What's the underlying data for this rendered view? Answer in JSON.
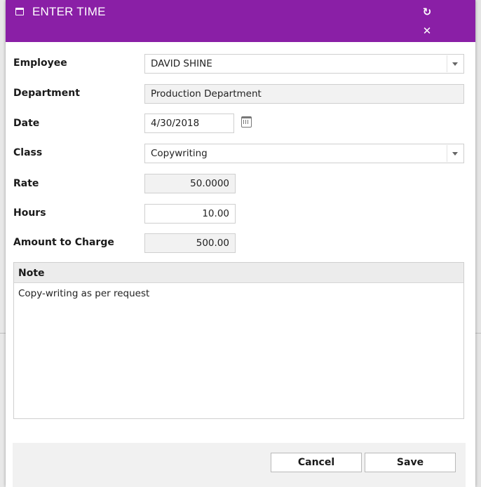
{
  "window": {
    "title": "ENTER TIME",
    "title_icon": "window-icon",
    "refresh_icon": "refresh-icon",
    "close_icon": "close-icon"
  },
  "form": {
    "employee": {
      "label": "Employee",
      "value": "DAVID SHINE"
    },
    "department": {
      "label": "Department",
      "value": "Production Department"
    },
    "date": {
      "label": "Date",
      "value": "4/30/2018",
      "icon": "calendar-icon"
    },
    "class": {
      "label": "Class",
      "value": "Copywriting"
    },
    "rate": {
      "label": "Rate",
      "value": "50.0000"
    },
    "hours": {
      "label": "Hours",
      "value": "10.00"
    },
    "amount": {
      "label": "Amount to Charge",
      "value": "500.00"
    }
  },
  "note": {
    "label": "Note",
    "value": "Copy-writing as per request"
  },
  "footer": {
    "cancel_label": "Cancel",
    "save_label": "Save"
  },
  "colors": {
    "titlebar": "#8a1fa6",
    "readonly_bg": "#f2f2f2",
    "footer_bg": "#f1f1f1"
  }
}
